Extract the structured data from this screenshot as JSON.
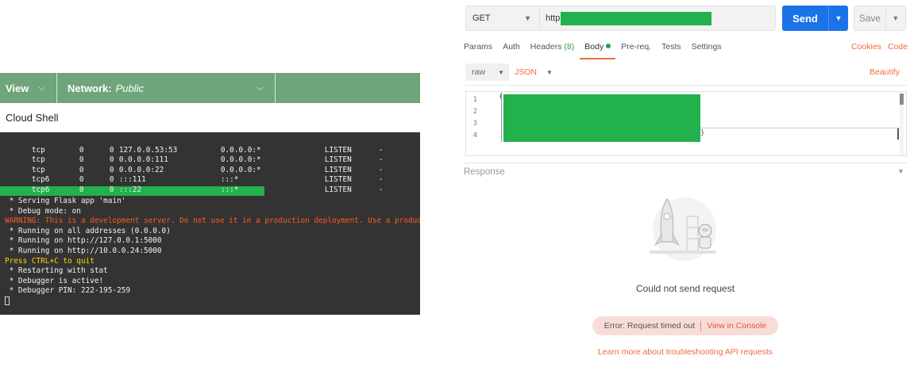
{
  "cloud_shell": {
    "view_label": "View",
    "network_label": "Network:",
    "network_value": "Public",
    "title": "Cloud Shell",
    "netstat_rows": [
      {
        "proto": "tcp",
        "recv": "0",
        "send": "0",
        "local": "127.0.0.53:53",
        "foreign": "0.0.0.0:*",
        "state": "LISTEN",
        "pid": "-"
      },
      {
        "proto": "tcp",
        "recv": "0",
        "send": "0",
        "local": "0.0.0.0:111",
        "foreign": "0.0.0.0:*",
        "state": "LISTEN",
        "pid": "-"
      },
      {
        "proto": "tcp",
        "recv": "0",
        "send": "0",
        "local": "0.0.0.0:22",
        "foreign": "0.0.0.0:*",
        "state": "LISTEN",
        "pid": "-"
      },
      {
        "proto": "tcp6",
        "recv": "0",
        "send": "0",
        "local": ":::111",
        "foreign": ":::*",
        "state": "LISTEN",
        "pid": "-"
      },
      {
        "proto": "tcp6",
        "recv": "0",
        "send": "0",
        "local": ":::22",
        "foreign": ":::*",
        "state": "LISTEN",
        "pid": "-"
      }
    ],
    "flask_lines": {
      "serving": " * Serving Flask app 'main'",
      "debug": " * Debug mode: on",
      "warning": "WARNING: This is a development server. Do not use it in a production deployment. Use a production",
      "running_all": " * Running on all addresses (0.0.0.0)",
      "running_local": " * Running on http://127.0.0.1:5000",
      "running_lan": " * Running on http://10.0.0.24:5000",
      "quit": "Press CTRL+C to quit",
      "restarting": " * Restarting with stat",
      "debugger_active": " * Debugger is active!",
      "debugger_pin": " * Debugger PIN: 222-195-259"
    },
    "redaction_color": "#22b14c"
  },
  "postman": {
    "method": "GET",
    "url_prefix": "http",
    "send_label": "Send",
    "save_label": "Save",
    "tabs": {
      "params": "Params",
      "auth": "Auth",
      "headers": "Headers",
      "headers_count": "(8)",
      "body": "Body",
      "prereq": "Pre-req.",
      "tests": "Tests",
      "settings": "Settings"
    },
    "cookies": "Cookies",
    "code": "Code",
    "body_mode": "raw",
    "body_language": "JSON",
    "beautify": "Beautify",
    "line_numbers": [
      "1",
      "2",
      "3",
      "4"
    ],
    "brace_open": "{",
    "brace_close": "}",
    "response_label": "Response",
    "no_send_text": "Could not send request",
    "error_text": "Error: Request timed out",
    "view_console": "View in Console",
    "learn_more": "Learn more about troubleshooting API requests",
    "accent_color": "#f26b3a",
    "send_color": "#1a73e8"
  }
}
